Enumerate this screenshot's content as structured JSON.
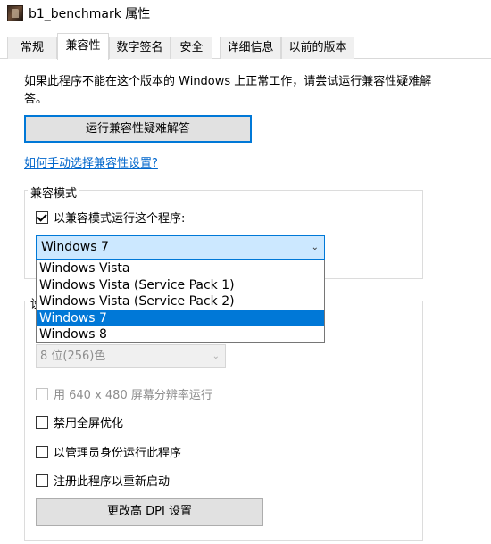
{
  "window": {
    "title": "b1_benchmark 属性",
    "icon": "app-icon"
  },
  "tabs": [
    {
      "label": "常规"
    },
    {
      "label": "兼容性"
    },
    {
      "label": "数字签名"
    },
    {
      "label": "安全"
    },
    {
      "label": "详细信息"
    },
    {
      "label": "以前的版本"
    }
  ],
  "active_tab": "兼容性",
  "intro_text": "如果此程序不能在这个版本的 Windows 上正常工作，请尝试运行兼容性疑难解答。",
  "troubleshoot_button": "运行兼容性疑难解答",
  "manual_link": "如何手动选择兼容性设置?",
  "compat_mode": {
    "legend": "兼容模式",
    "checkbox_label": "以兼容模式运行这个程序:",
    "checked": true,
    "selected_value": "Windows 7",
    "options": [
      "Windows Vista",
      "Windows Vista (Service Pack 1)",
      "Windows Vista (Service Pack 2)",
      "Windows 7",
      "Windows 8"
    ]
  },
  "settings": {
    "legend_visible": "设",
    "color_select_value": "8 位(256)色",
    "resolution_label": "用 640 x 480 屏幕分辨率运行",
    "fullscreen_label": "禁用全屏优化",
    "admin_label": "以管理员身份运行此程序",
    "restart_label": "注册此程序以重新启动",
    "dpi_button": "更改高 DPI 设置"
  },
  "colors": {
    "accent": "#0078d7",
    "link": "#0066cc",
    "selection": "#cce8ff"
  }
}
